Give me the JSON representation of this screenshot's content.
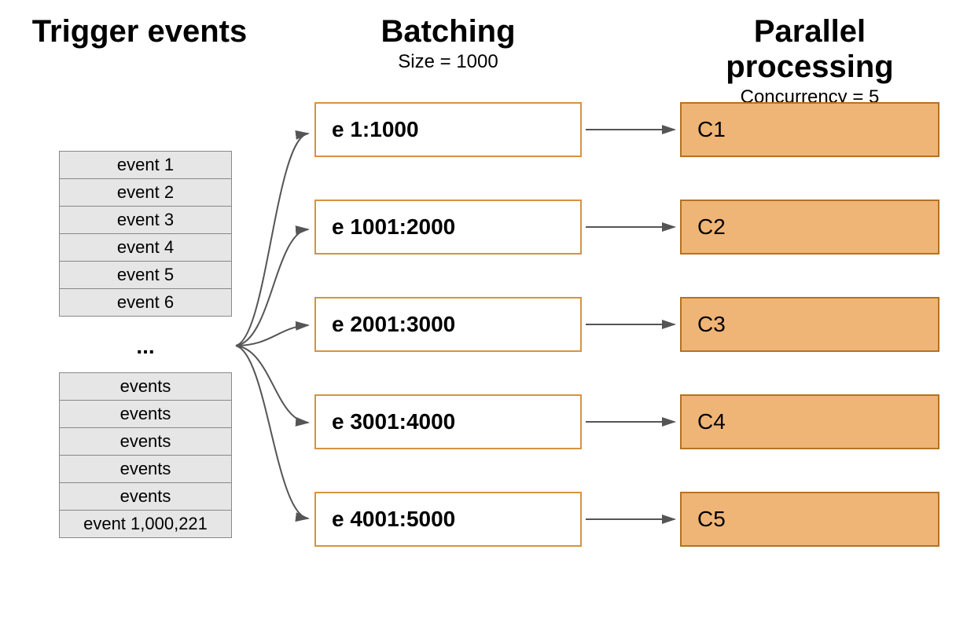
{
  "columns": {
    "events": {
      "title": "Trigger events"
    },
    "batching": {
      "title": "Batching",
      "subtitle": "Size = 1000"
    },
    "parallel": {
      "title": "Parallel processing",
      "subtitle": "Concurrency = 5"
    }
  },
  "events_top": [
    "event 1",
    "event 2",
    "event 3",
    "event 4",
    "event 5",
    "event 6"
  ],
  "events_ellipsis": "...",
  "events_bot": [
    "events",
    "events",
    "events",
    "events",
    "events",
    "event 1,000,221"
  ],
  "batches": [
    "e 1:1000",
    "e 1001:2000",
    "e 2001:3000",
    "e 3001:4000",
    "e 4001:5000"
  ],
  "processors": [
    "C1",
    "C2",
    "C3",
    "C4",
    "C5"
  ]
}
